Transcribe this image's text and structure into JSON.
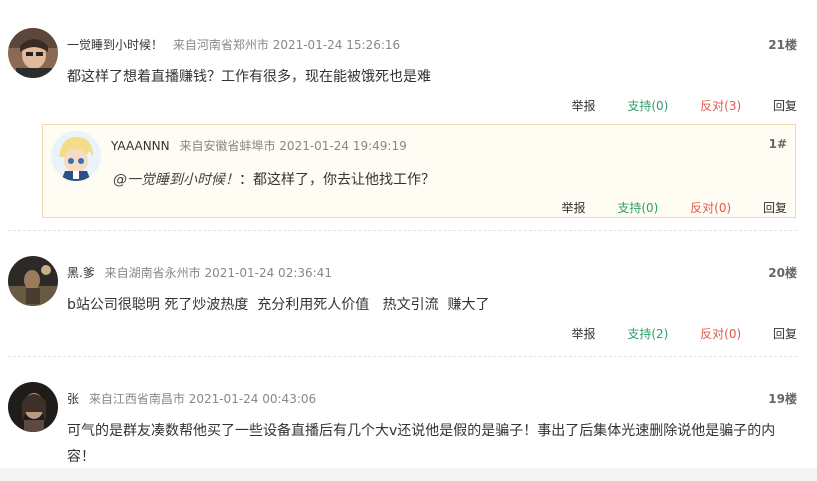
{
  "comments": [
    {
      "user": "一觉睡到小时候！",
      "location": "来自河南省郑州市",
      "time": "2021-01-24 15:26:16",
      "floor": "21楼",
      "text": "都这样了想着直播赚钱？工作有很多，现在能被饿死也是难",
      "actions": {
        "report": "举报",
        "support": "支持(0)",
        "oppose": "反对(3)",
        "reply": "回复"
      },
      "reply": {
        "user": "YAAANNN",
        "location": "来自安徽省蚌埠市",
        "time": "2021-01-24 19:49:19",
        "floor": "1#",
        "mention": "@一觉睡到小时候！",
        "text": "：都这样了，你去让他找工作？",
        "actions": {
          "report": "举报",
          "support": "支持(0)",
          "oppose": "反对(0)",
          "reply": "回复"
        }
      }
    },
    {
      "user": "黑.爹",
      "location": "来自湖南省永州市",
      "time": "2021-01-24 02:36:41",
      "floor": "20楼",
      "text": "b站公司很聪明 死了炒波热度  充分利用死人价值   热文引流  赚大了",
      "actions": {
        "report": "举报",
        "support": "支持(2)",
        "oppose": "反对(0)",
        "reply": "回复"
      }
    },
    {
      "user": "张",
      "location": "来自江西省南昌市",
      "time": "2021-01-24 00:43:06",
      "floor": "19楼",
      "text": "可气的是群友凑数帮他买了一些设备直播后有几个大v还说他是假的是骗子！事出了后集体光速删除说他是骗子的内容！"
    }
  ],
  "colors": {
    "support": "#2f9e6b",
    "oppose": "#e05a52",
    "reply_bg": "#fffcf3",
    "reply_border": "#f0d9ae"
  }
}
